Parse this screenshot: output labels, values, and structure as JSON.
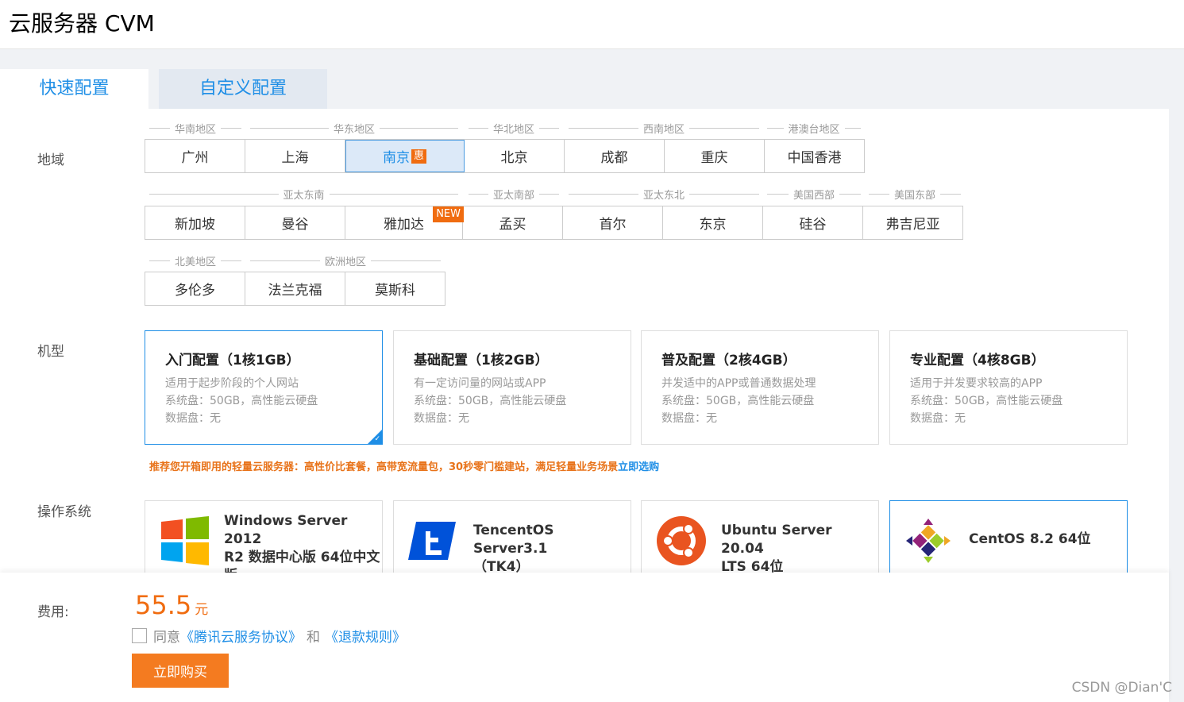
{
  "header": {
    "title": "云服务器 CVM"
  },
  "tabs": [
    {
      "label": "快速配置"
    },
    {
      "label": "自定义配置"
    }
  ],
  "region": {
    "label": "地域",
    "groups_row1": [
      "华南地区",
      "华东地区",
      "华北地区",
      "西南地区",
      "港澳台地区"
    ],
    "row1": [
      "广州",
      "上海",
      "南京",
      "北京",
      "成都",
      "重庆",
      "中国香港"
    ],
    "hui_badge": "惠",
    "groups_row2": [
      "亚太东南",
      "亚太南部",
      "亚太东北",
      "美国西部",
      "美国东部"
    ],
    "row2": [
      "新加坡",
      "曼谷",
      "雅加达",
      "孟买",
      "首尔",
      "东京",
      "硅谷",
      "弗吉尼亚"
    ],
    "new_badge": "NEW",
    "groups_row3": [
      "北美地区",
      "欧洲地区"
    ],
    "row3": [
      "多伦多",
      "法兰克福",
      "莫斯科"
    ]
  },
  "machine": {
    "label": "机型",
    "cards": [
      {
        "title": "入门配置（1核1GB）",
        "desc": "适用于起步阶段的个人网站",
        "disk": "系统盘：50GB，高性能云硬盘",
        "data": "数据盘：无"
      },
      {
        "title": "基础配置（1核2GB）",
        "desc": "有一定访问量的网站或APP",
        "disk": "系统盘：50GB，高性能云硬盘",
        "data": "数据盘：无"
      },
      {
        "title": "普及配置（2核4GB）",
        "desc": "并发适中的APP或普通数据处理",
        "disk": "系统盘：50GB，高性能云硬盘",
        "data": "数据盘：无"
      },
      {
        "title": "专业配置（4核8GB）",
        "desc": "适用于并发要求较高的APP",
        "disk": "系统盘：50GB，高性能云硬盘",
        "data": "数据盘：无"
      }
    ],
    "promo": "推荐您开箱即用的轻量云服务器：高性价比套餐，高带宽流量包，30秒零门槛建站，满足轻量业务场景",
    "promo_link": "立即选购"
  },
  "os": {
    "label": "操作系统",
    "cards": [
      {
        "name1": "Windows Server 2012",
        "name2": "R2 数据中心版 64位中文",
        "name3": "版",
        "icon": "windows-icon"
      },
      {
        "name1": "TencentOS Server3.1",
        "name2": "（TK4）",
        "icon": "tencentos-icon"
      },
      {
        "name1": "Ubuntu Server 20.04",
        "name2": "LTS 64位",
        "icon": "ubuntu-icon"
      },
      {
        "name1": "CentOS 8.2 64位",
        "icon": "centos-icon"
      }
    ]
  },
  "footer": {
    "fee_label": "费用:",
    "price": "55.5",
    "unit": "元",
    "agree_prefix": "同意",
    "agree_link1": "《腾讯云服务协议》",
    "agree_and": "和",
    "agree_link2": "《退款规则》",
    "buy": "立即购买"
  },
  "watermark": "CSDN @Dian'C",
  "colors": {
    "accent": "#1e8ee6",
    "orange": "#f06c10"
  }
}
